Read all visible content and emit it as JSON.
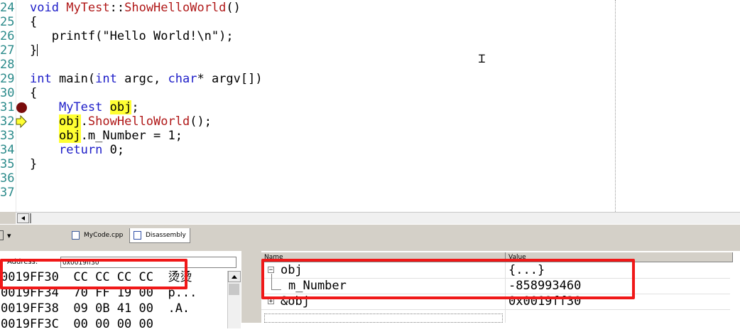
{
  "editor": {
    "line_numbers": [
      "24",
      "25",
      "26",
      "27",
      "28",
      "29",
      "30",
      "31",
      "32",
      "33",
      "34",
      "35",
      "36",
      "37"
    ],
    "lines": {
      "l24": {
        "kw": "void",
        "sp": " ",
        "cls": "MyTest",
        "sep": "::",
        "fn": "ShowHelloWorld",
        "end": "()"
      },
      "l25": "{",
      "l26": {
        "indent": "   ",
        "call": "printf(\"Hello World!\\n\");"
      },
      "l27": "}",
      "l29": {
        "kw1": "int",
        "name": " main(",
        "kw2": "int",
        "a1": " argc, ",
        "kw3": "char",
        "a2": "* argv[])"
      },
      "l30": "{",
      "l31": {
        "indent": "    ",
        "type": "MyTest",
        "sp": " ",
        "var": "obj",
        "end": ";"
      },
      "l32": {
        "indent": "    ",
        "var": "obj",
        "dot": ".",
        "fn": "ShowHelloWorld",
        "end": "();"
      },
      "l33": {
        "indent": "    ",
        "var": "obj",
        "rest": ".m_Number = 1;"
      },
      "l34": {
        "indent": "    ",
        "kw": "return",
        "rest": " 0;"
      },
      "l35": "}"
    },
    "breakpoint_line": "31",
    "current_line": "32"
  },
  "tabs": [
    {
      "label": "MyCode.cpp",
      "icon": "file-icon",
      "active": false
    },
    {
      "label": "Disassembly",
      "icon": "disassembly-icon",
      "active": true
    }
  ],
  "memory": {
    "address_label": "Address:",
    "address_value": "0x0019ff30",
    "rows": [
      {
        "addr": "0019FF30",
        "bytes": "CC CC CC CC",
        "ascii": "烫烫"
      },
      {
        "addr": "0019FF34",
        "bytes": "70 FF 19 00",
        "ascii": "p..."
      },
      {
        "addr": "0019FF38",
        "bytes": "09 0B 41 00",
        "ascii": ".A."
      },
      {
        "addr": "0019FF3C",
        "bytes": "00 00 00 00",
        "ascii": ""
      }
    ]
  },
  "watch": {
    "col_name": "Name",
    "col_value": "Value",
    "rows": [
      {
        "name": "obj",
        "value": "{...}",
        "expander": "−"
      },
      {
        "name": "m_Number",
        "value": "-858993460",
        "expander": ""
      },
      {
        "name": "&obj",
        "value": "0x0019ff30",
        "expander": "+"
      }
    ]
  },
  "colors": {
    "highlight": "#ffff33",
    "keyword": "#1c1cc8",
    "function": "#b01818",
    "annotation": "#f01818",
    "breakpoint": "#7a0c0c"
  }
}
